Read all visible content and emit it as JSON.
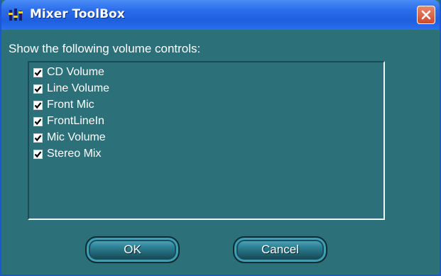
{
  "window": {
    "title": "Mixer ToolBox",
    "icon": "mixer-app-icon",
    "close_icon": "close-icon"
  },
  "prompt": "Show the following volume controls:",
  "controls": [
    {
      "label": "CD Volume",
      "checked": true
    },
    {
      "label": "Line Volume",
      "checked": true
    },
    {
      "label": "Front Mic",
      "checked": true
    },
    {
      "label": "FrontLineIn",
      "checked": true
    },
    {
      "label": "Mic Volume",
      "checked": true
    },
    {
      "label": "Stereo Mix",
      "checked": true
    }
  ],
  "buttons": {
    "ok_label": "OK",
    "cancel_label": "Cancel"
  },
  "colors": {
    "titlebar": "#2a6cea",
    "body": "#2c707a",
    "close": "#cf4a2c"
  }
}
